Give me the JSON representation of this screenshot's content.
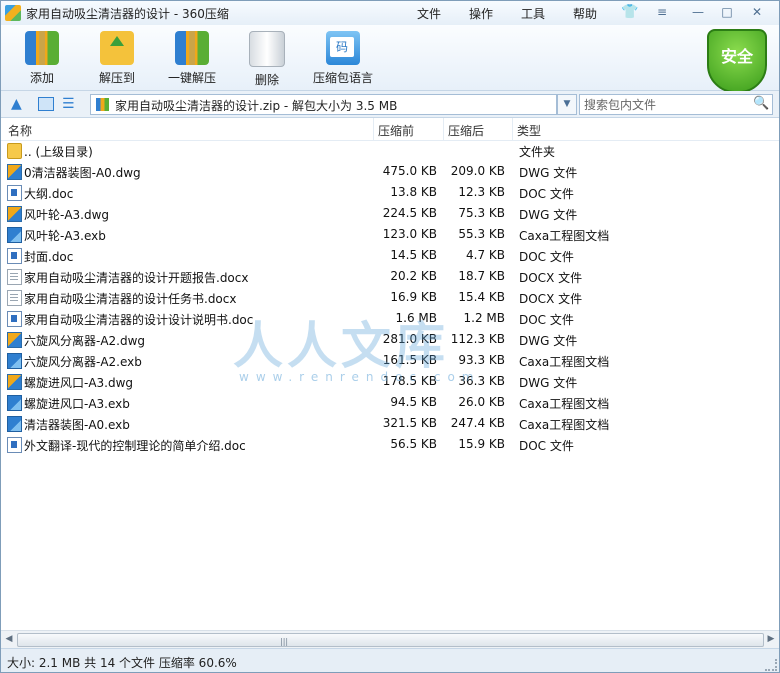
{
  "window": {
    "title": "家用自动吸尘清洁器的设计 - 360压缩",
    "menu": {
      "file": "文件",
      "operate": "操作",
      "tools": "工具",
      "help": "帮助"
    },
    "controls": {
      "menu_glyph": "≡",
      "min_glyph": "—",
      "max_glyph": "□",
      "close_glyph": "✕"
    }
  },
  "toolbar": {
    "add": "添加",
    "extract_to": "解压到",
    "one_click_extract": "一键解压",
    "delete": "删除",
    "comment_code": "压缩包语言",
    "code_glyph": "码",
    "security_badge": "安全"
  },
  "address": {
    "path": "家用自动吸尘清洁器的设计.zip - 解包大小为 3.5 MB",
    "v_glyph": "V",
    "search_placeholder": "搜索包内文件"
  },
  "columns": {
    "name": "名称",
    "compressed": "压缩前",
    "original": "压缩后",
    "type": "类型"
  },
  "files": [
    {
      "name": ".. (上级目录)",
      "compressed": "",
      "original": "",
      "type": "文件夹",
      "icon": "folder-icon"
    },
    {
      "name": "0清洁器装图-A0.dwg",
      "compressed": "475.0 KB",
      "original": "209.0 KB",
      "type": "DWG 文件",
      "icon": "dwg-file-icon"
    },
    {
      "name": "大纲.doc",
      "compressed": "13.8 KB",
      "original": "12.3 KB",
      "type": "DOC 文件",
      "icon": "doc-file-icon"
    },
    {
      "name": "风叶轮-A3.dwg",
      "compressed": "224.5 KB",
      "original": "75.3 KB",
      "type": "DWG 文件",
      "icon": "dwg-file-icon"
    },
    {
      "name": "风叶轮-A3.exb",
      "compressed": "123.0 KB",
      "original": "55.3 KB",
      "type": "Caxa工程图文档",
      "icon": "exb-file-icon"
    },
    {
      "name": "封面.doc",
      "compressed": "14.5 KB",
      "original": "4.7 KB",
      "type": "DOC 文件",
      "icon": "doc-file-icon"
    },
    {
      "name": "家用自动吸尘清洁器的设计开题报告.docx",
      "compressed": "20.2 KB",
      "original": "18.7 KB",
      "type": "DOCX 文件",
      "icon": "docx-file-icon"
    },
    {
      "name": "家用自动吸尘清洁器的设计任务书.docx",
      "compressed": "16.9 KB",
      "original": "15.4 KB",
      "type": "DOCX 文件",
      "icon": "docx-file-icon"
    },
    {
      "name": "家用自动吸尘清洁器的设计设计说明书.doc",
      "compressed": "1.6 MB",
      "original": "1.2 MB",
      "type": "DOC 文件",
      "icon": "doc-file-icon"
    },
    {
      "name": "六旋风分离器-A2.dwg",
      "compressed": "281.0 KB",
      "original": "112.3 KB",
      "type": "DWG 文件",
      "icon": "dwg-file-icon"
    },
    {
      "name": "六旋风分离器-A2.exb",
      "compressed": "161.5 KB",
      "original": "93.3 KB",
      "type": "Caxa工程图文档",
      "icon": "exb-file-icon"
    },
    {
      "name": "螺旋进风口-A3.dwg",
      "compressed": "178.5 KB",
      "original": "36.3 KB",
      "type": "DWG 文件",
      "icon": "dwg-file-icon"
    },
    {
      "name": "螺旋进风口-A3.exb",
      "compressed": "94.5 KB",
      "original": "26.0 KB",
      "type": "Caxa工程图文档",
      "icon": "exb-file-icon"
    },
    {
      "name": "清洁器装图-A0.exb",
      "compressed": "321.5 KB",
      "original": "247.4 KB",
      "type": "Caxa工程图文档",
      "icon": "exb-file-icon"
    },
    {
      "name": "外文翻译-现代的控制理论的简单介绍.doc",
      "compressed": "56.5 KB",
      "original": "15.9 KB",
      "type": "DOC 文件",
      "icon": "doc-file-icon"
    }
  ],
  "watermark": {
    "text": "人人文库",
    "url": "www.renrendoc.com"
  },
  "status": {
    "text": "大小: 2.1 MB 共 14 个文件 压缩率 60.6%"
  }
}
